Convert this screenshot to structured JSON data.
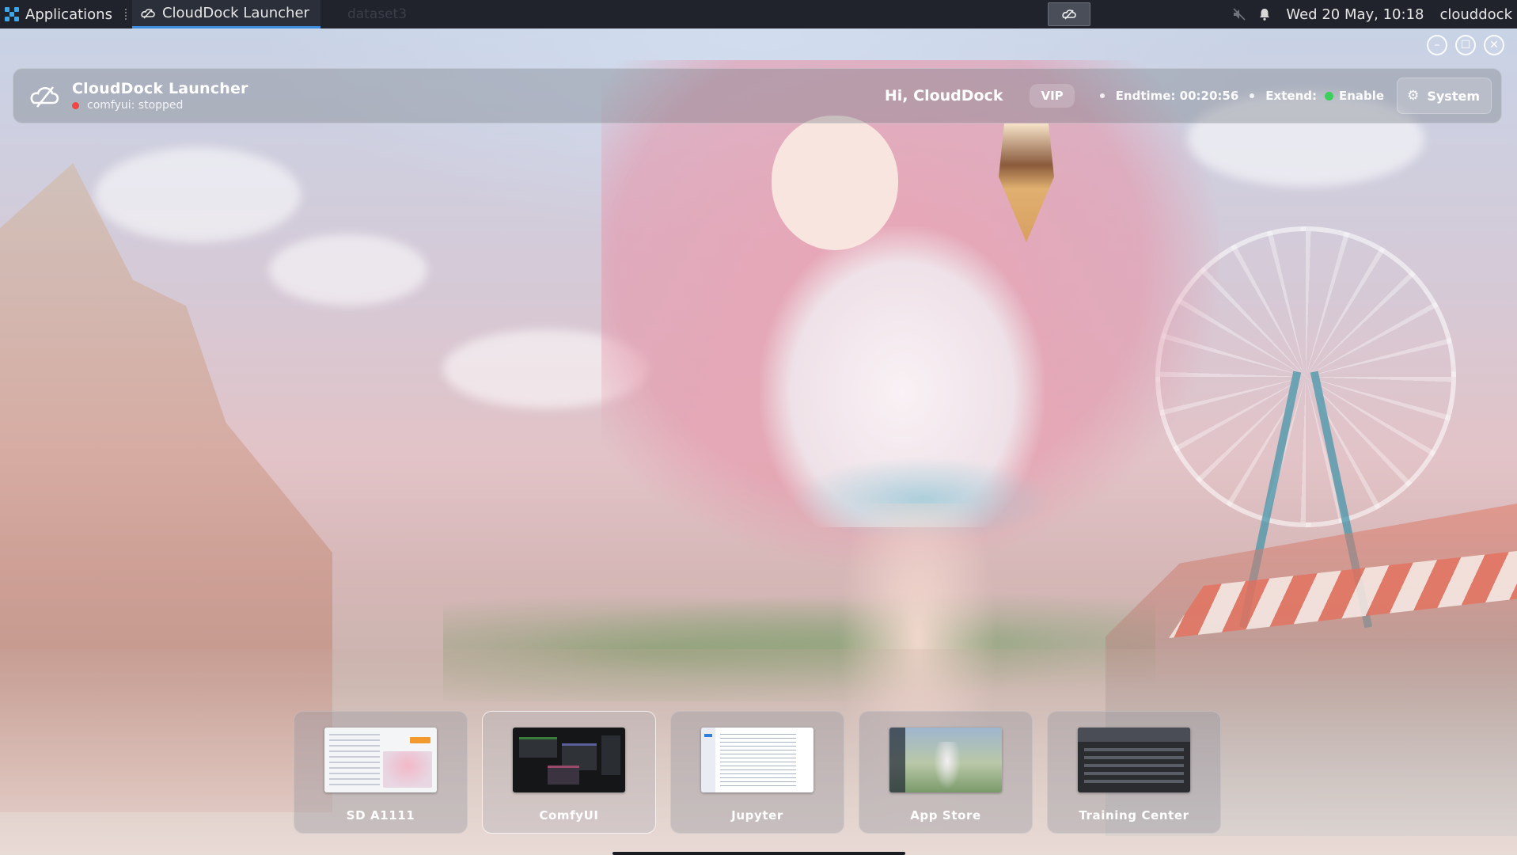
{
  "taskbar": {
    "applications_label": "Applications",
    "active_window_title": "CloudDock Launcher",
    "inactive_window_title": "dataset3",
    "clock": "Wed 20 May, 10:18",
    "user": "clouddock"
  },
  "window_controls": {
    "minimize": "–",
    "maximize": "☐",
    "close": "✕"
  },
  "header": {
    "title": "CloudDock Launcher",
    "status_text": "comfyui: stopped",
    "greeting": "Hi, CloudDock",
    "badge": "VIP",
    "endtime_text": "Endtime: 00:20:56",
    "extend_label": "Extend:",
    "extend_value": "Enable",
    "system_button": "System"
  },
  "apps": [
    {
      "label": "SD A1111",
      "active": false
    },
    {
      "label": "ComfyUI",
      "active": true
    },
    {
      "label": "Jupyter",
      "active": false
    },
    {
      "label": "App Store",
      "active": false
    },
    {
      "label": "Training Center",
      "active": false
    }
  ],
  "colors": {
    "taskbar_bg": "#20232b",
    "accent_blue": "#3d8ee0",
    "status_stopped": "#f04646",
    "status_enabled": "#3ccf5b"
  },
  "icons": {
    "applications": "apps-grid-icon",
    "launcher": "clouddock-logo-icon",
    "mute": "speaker-muted-icon",
    "notifications": "bell-icon",
    "system": "gear-icon"
  }
}
